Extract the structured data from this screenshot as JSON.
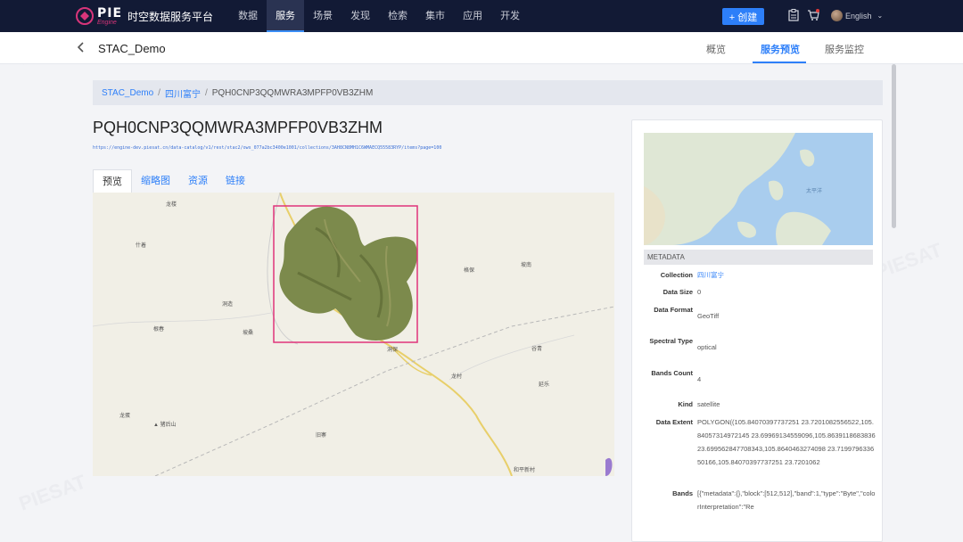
{
  "nav": {
    "logo_text": "PIE",
    "logo_sub": "Engine",
    "platform_title": "时空数据服务平台",
    "items": [
      {
        "label": "数据",
        "active": false
      },
      {
        "label": "服务",
        "active": true
      },
      {
        "label": "场景",
        "active": false
      },
      {
        "label": "发现",
        "active": false
      },
      {
        "label": "检索",
        "active": false
      },
      {
        "label": "集市",
        "active": false
      },
      {
        "label": "应用",
        "active": false
      },
      {
        "label": "开发",
        "active": false
      }
    ],
    "create_label": "+ 创建",
    "lang_label": "English"
  },
  "subheader": {
    "back_icon": "chevron-left-icon",
    "title": "STAC_Demo",
    "tabs": [
      {
        "label": "概览",
        "active": false
      },
      {
        "label": "服务预览",
        "active": true
      },
      {
        "label": "服务监控",
        "active": false
      }
    ]
  },
  "breadcrumb": {
    "items": [
      "STAC_Demo",
      "四川富宁"
    ],
    "current": "PQH0CNP3QQMWRA3MPFP0VB3ZHM"
  },
  "item": {
    "title": "PQH0CNP3QQMWRA3MPFP0VB3ZHM",
    "url": "https://engine-dev.piesat.cn/data-catalog/v1/rest/stac2/ows_077a2bc3400e1001/collections/3AH8CN8MH1C6WMAECQ55583RYP/items?page=100"
  },
  "tabs": [
    {
      "label": "预览",
      "active": true
    },
    {
      "label": "缩略图",
      "active": false
    },
    {
      "label": "资源",
      "active": false
    },
    {
      "label": "链接",
      "active": false
    }
  ],
  "map_labels": [
    {
      "text": "龙楼"
    },
    {
      "text": "什着"
    },
    {
      "text": "洞造"
    },
    {
      "text": "坡桑"
    },
    {
      "text": "根春"
    },
    {
      "text": "格保"
    },
    {
      "text": "坡南"
    },
    {
      "text": "谷青"
    },
    {
      "text": "洞保"
    },
    {
      "text": "龙村"
    },
    {
      "text": "延乐"
    },
    {
      "text": "龙蛋"
    },
    {
      "text": "▲ 猪后山"
    },
    {
      "text": "旧寨"
    },
    {
      "text": "和平新村"
    }
  ],
  "overview": {
    "ocean_label": "太平洋"
  },
  "metadata": {
    "header": "METADATA",
    "rows": [
      {
        "key": "Collection",
        "value": "四川富宁",
        "link": true
      },
      {
        "key": "Data Size",
        "value": "0",
        "link": false
      },
      {
        "key": "Data Format",
        "value": "GeoTiff",
        "link": false
      },
      {
        "key": "Spectral Type",
        "value": "optical",
        "link": false
      },
      {
        "key": "Bands Count",
        "value": "4",
        "link": false
      },
      {
        "key": "Kind",
        "value": "satellite",
        "link": false
      },
      {
        "key": "Data Extent",
        "value": "POLYGON((105.84070397737251 23.7201082556522,105.84057314972145 23.69969134559096,105.8639118683836 23.699562847708343,105.8640463274098 23.719979633650166,105.84070397737251 23.7201062",
        "link": false
      },
      {
        "key": "Bands",
        "value": "[{\"metadata\":{},\"block\":[512,512],\"band\":1,\"type\":\"Byte\",\"colorInterpretation\":\"Re",
        "link": false
      }
    ]
  },
  "colors": {
    "nav_bg": "#121a35",
    "accent": "#2d7ff9",
    "footprint": "#e0337a"
  }
}
